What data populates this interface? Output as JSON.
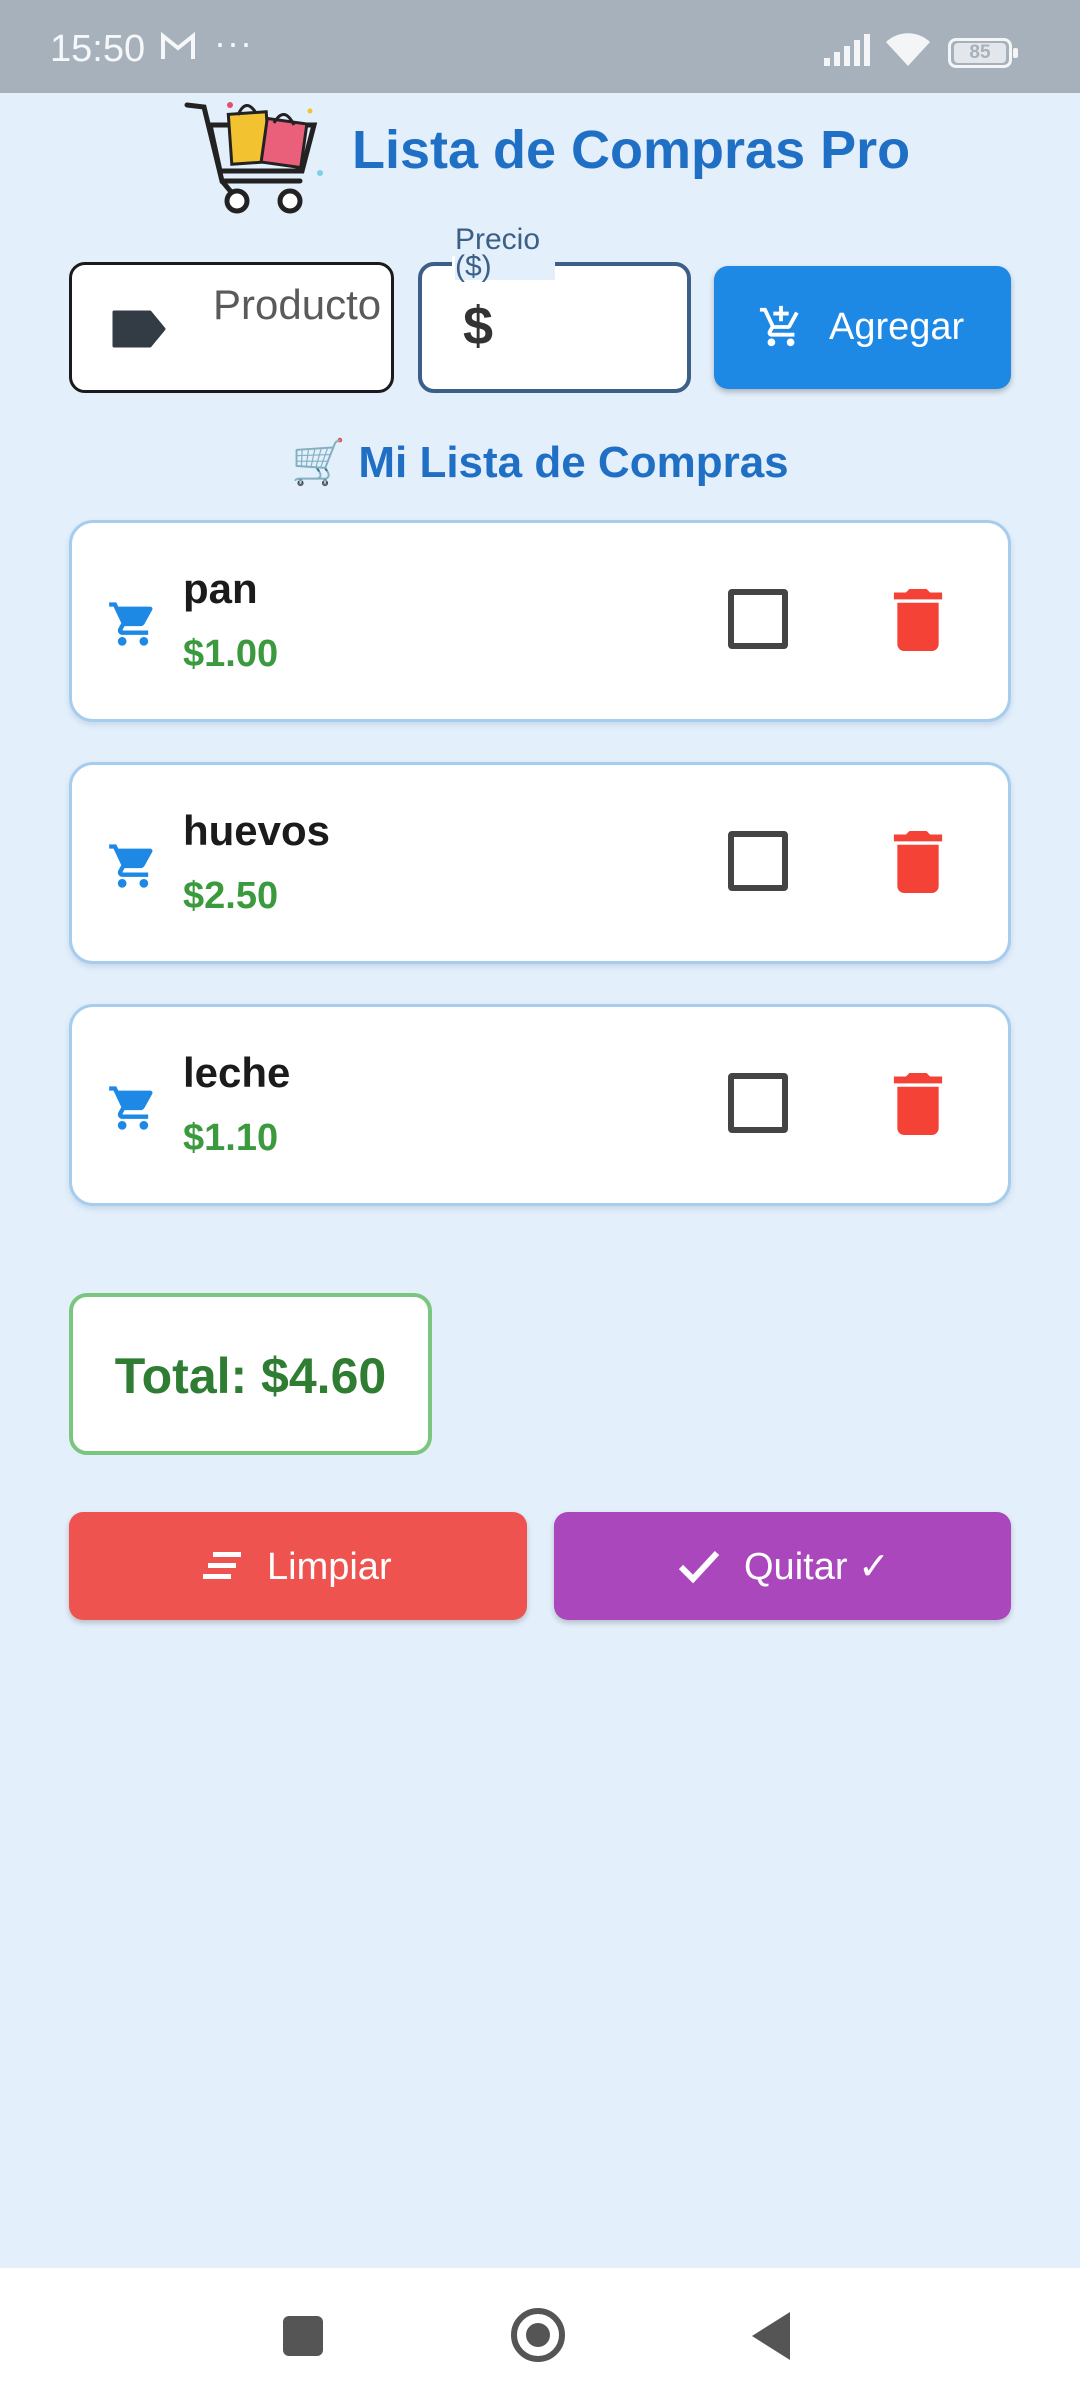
{
  "status_bar": {
    "time": "15:50",
    "dots": "···",
    "battery": "85"
  },
  "header": {
    "title": "Lista de Compras Pro"
  },
  "form": {
    "product_placeholder": "Producto",
    "price_label": "Precio ($)",
    "price_prefix": "$",
    "add_label": "Agregar"
  },
  "list": {
    "title": "🛒 Mi Lista de Compras",
    "items": [
      {
        "name": "pan",
        "price": "$1.00",
        "checked": false
      },
      {
        "name": "huevos",
        "price": "$2.50",
        "checked": false
      },
      {
        "name": "leche",
        "price": "$1.10",
        "checked": false
      }
    ]
  },
  "total": {
    "text": "Total: $4.60"
  },
  "actions": {
    "clear_label": "Limpiar",
    "remove_label": "Quitar ✓"
  },
  "colors": {
    "accent": "#1e88e5",
    "title": "#1f6fc4",
    "price": "#3b9a3e",
    "delete": "#f44336",
    "clear": "#ef5350",
    "remove": "#ab47bc",
    "background": "#e3effb"
  }
}
